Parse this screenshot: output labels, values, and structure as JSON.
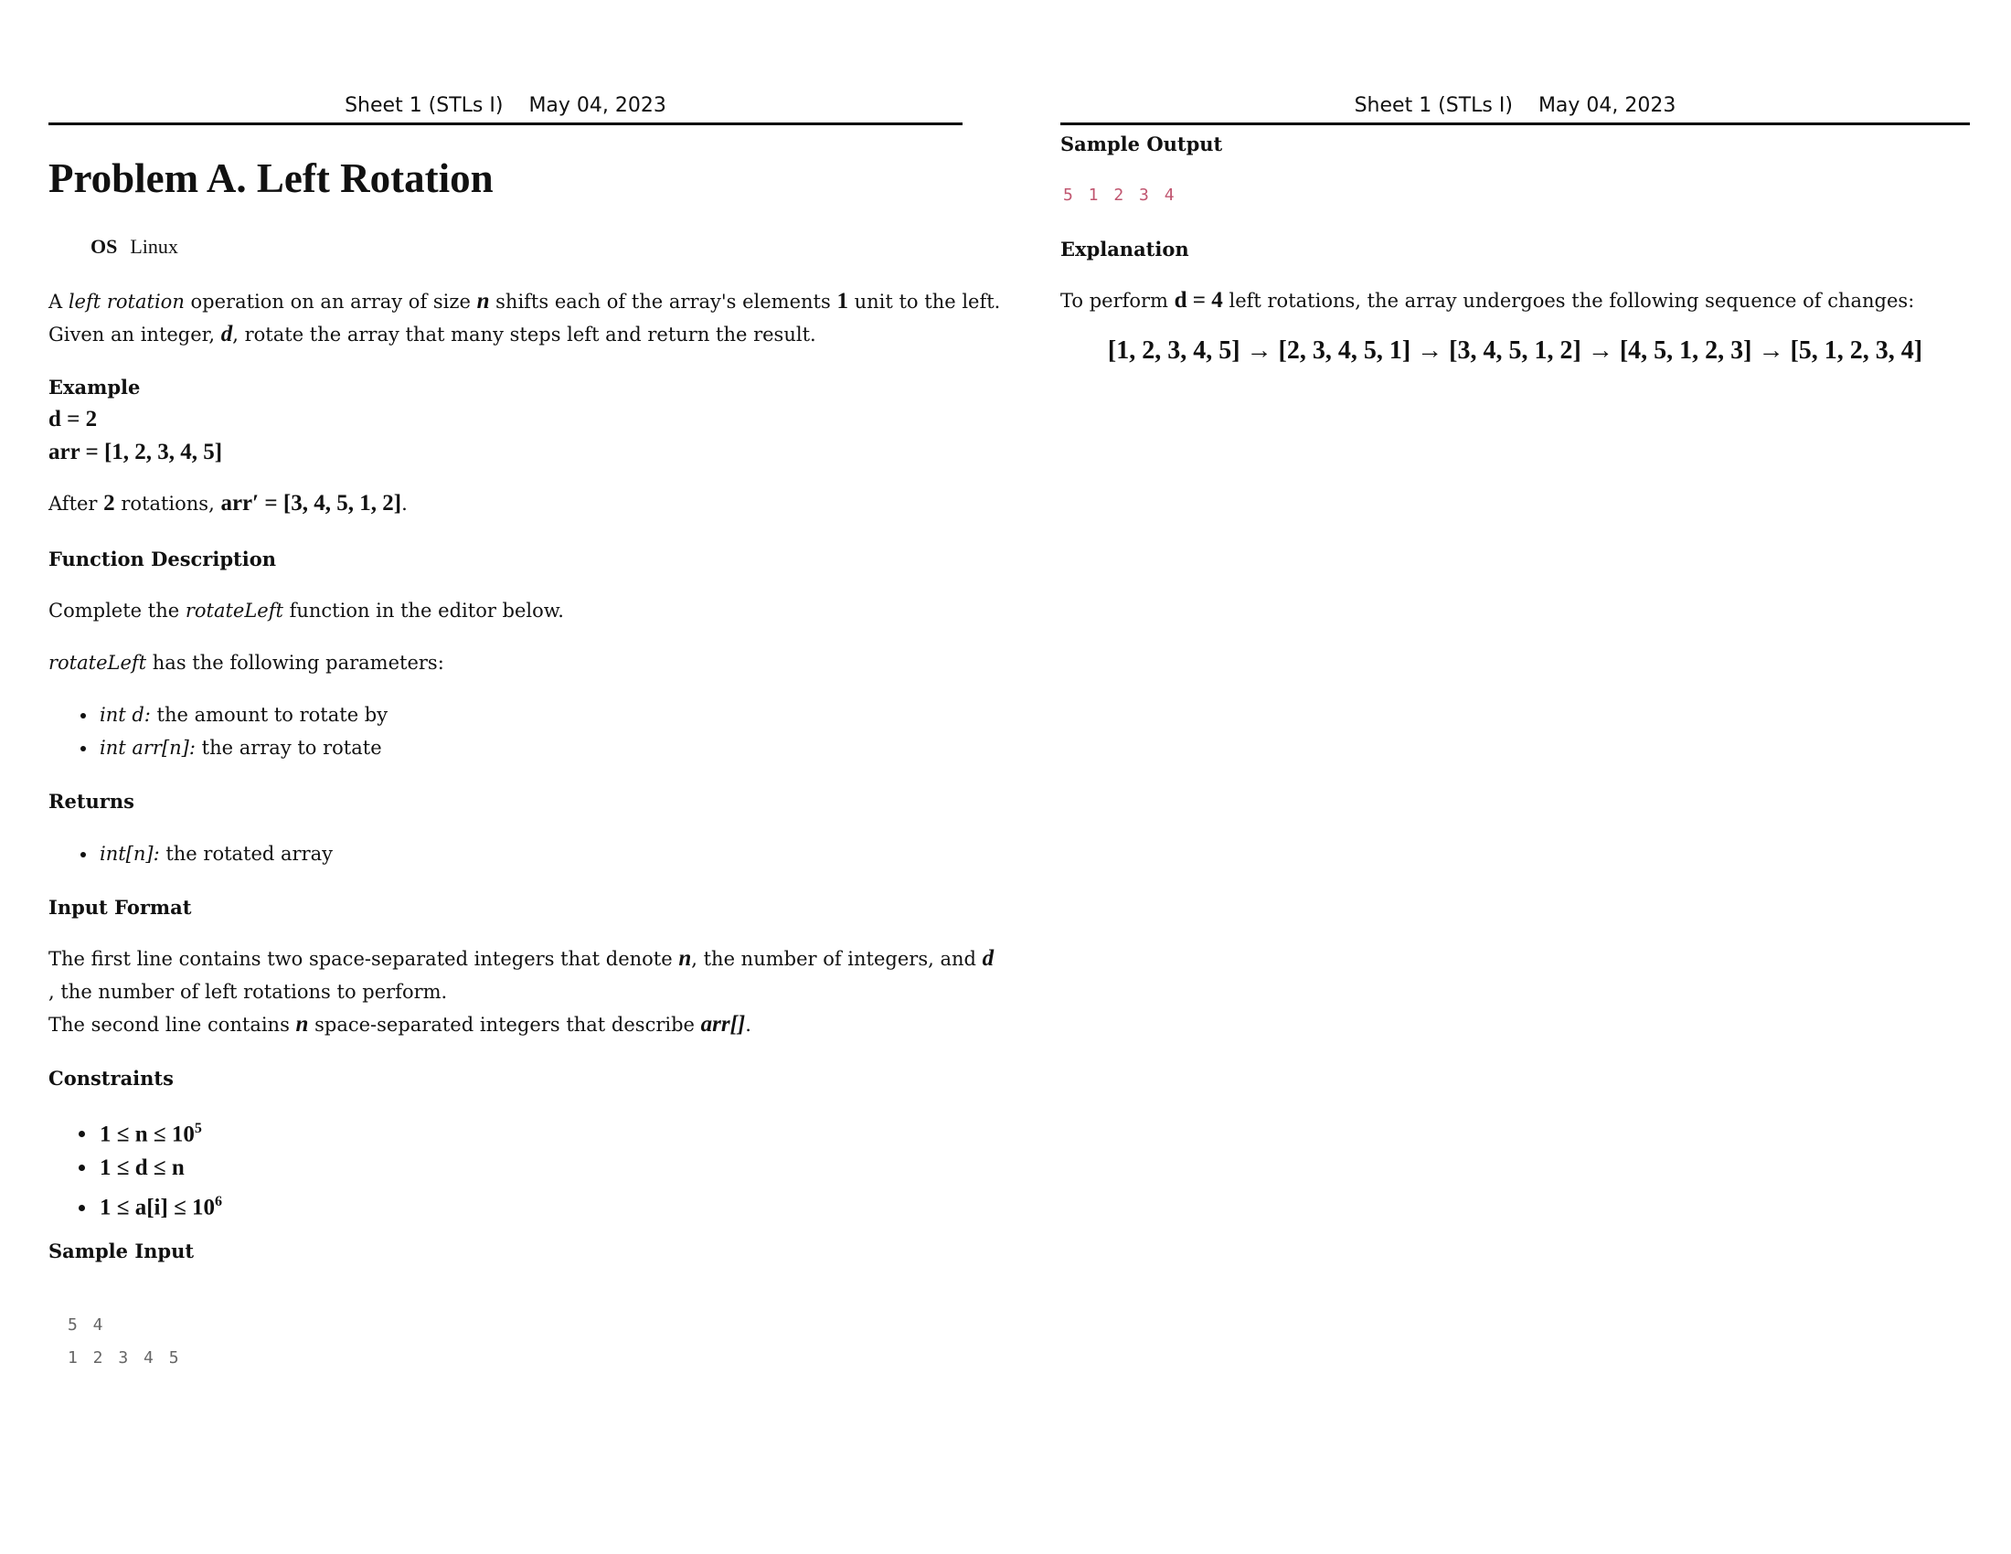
{
  "header": {
    "sheet": "Sheet 1 (STLs I)",
    "date": "May 04, 2023"
  },
  "problem": {
    "title": "Problem A. Left Rotation",
    "os_label": "OS",
    "os_value": "Linux"
  },
  "intro": {
    "p1_a": "A ",
    "p1_em": "left rotation",
    "p1_b": " operation on an array of size ",
    "p1_var_n": "n",
    "p1_c": " shifts each of the array's elements ",
    "p1_one": "1",
    "p1_d": " unit to the left.",
    "p2_a": "Given an integer, ",
    "p2_var_d": "d",
    "p2_b": ", rotate the array that many steps left and return the result."
  },
  "example": {
    "heading": "Example",
    "d_line": "d = 2",
    "arr_line": "arr = [1, 2, 3, 4, 5]",
    "after_a": "After ",
    "after_num": "2",
    "after_b": " rotations, ",
    "after_math": "arr′ = [3, 4, 5, 1, 2]",
    "after_c": "."
  },
  "function_description": {
    "heading": "Function Description",
    "line1_a": "Complete the ",
    "line1_em": "rotateLeft",
    "line1_b": " function in the editor below.",
    "line2_em": "rotateLeft",
    "line2_b": " has the following parameters:",
    "params": [
      {
        "name": "int d:",
        "desc": " the amount to rotate by"
      },
      {
        "name": "int arr[n]:",
        "desc": " the array to rotate"
      }
    ]
  },
  "returns": {
    "heading": "Returns",
    "items": [
      {
        "name": "int[n]:",
        "desc": " the rotated array"
      }
    ]
  },
  "input_format": {
    "heading": "Input Format",
    "l1_a": "The first line contains two space-separated integers that denote ",
    "l1_n": "n",
    "l1_b": ", the number of integers, and ",
    "l1_d": "d",
    "l2": ", the number of left rotations to perform.",
    "l3_a": "The second line contains ",
    "l3_n": "n",
    "l3_b": " space-separated integers that describe ",
    "l3_arr": "arr[]",
    "l3_c": "."
  },
  "constraints": {
    "heading": "Constraints",
    "c1": "1 ≤ n ≤ 10",
    "c1_exp": "5",
    "c2": "1 ≤ d ≤ n",
    "c3": "1 ≤ a[i] ≤ 10",
    "c3_exp": "6"
  },
  "sample_input": {
    "heading": "Sample Input",
    "line1": "5 4",
    "line2": "1 2 3 4 5"
  },
  "sample_output": {
    "heading": "Sample Output",
    "line1": "5 1 2 3 4"
  },
  "explanation": {
    "heading": "Explanation",
    "text_a": "To perform ",
    "text_math": "d = 4",
    "text_b": " left rotations, the array undergoes the following sequence of changes:",
    "sequence": "[1, 2, 3, 4, 5] → [2, 3, 4, 5, 1] → [3, 4, 5, 1, 2] → [4, 5, 1, 2, 3] → [5, 1, 2, 3, 4]"
  }
}
